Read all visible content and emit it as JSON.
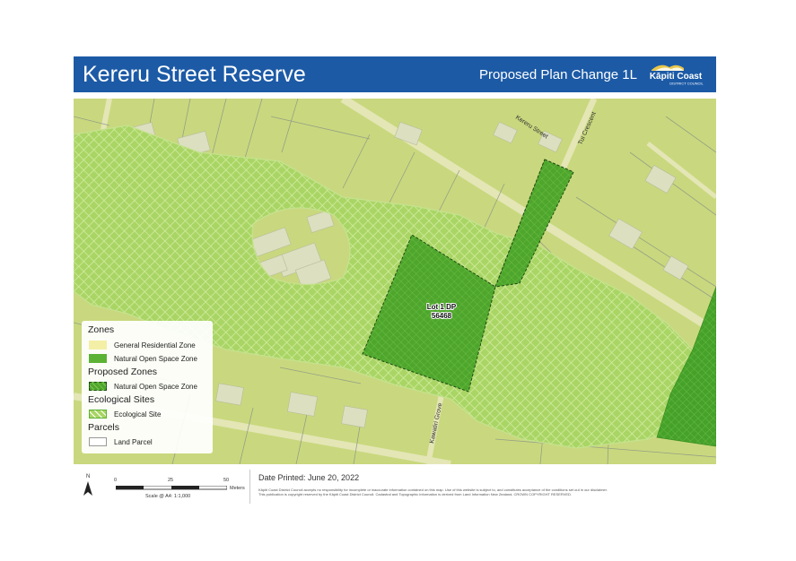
{
  "header": {
    "title": "Kereru Street Reserve",
    "subtitle": "Proposed Plan Change 1L",
    "logo_name": "Kāpiti Coast",
    "logo_sub": "DISTRICT COUNCIL"
  },
  "map": {
    "streets": [
      "Kereru Street",
      "Tui Crescent",
      "Kawatiri Grove"
    ],
    "lot_label_1": "Lot 1 DP",
    "lot_label_2": "56468"
  },
  "legend": {
    "zones_heading": "Zones",
    "general_residential": "General Residential Zone",
    "natural_open_space": "Natural Open Space Zone",
    "proposed_heading": "Proposed Zones",
    "proposed_natural_open_space": "Natural Open Space Zone",
    "ecological_heading": "Ecological Sites",
    "ecological_site": "Ecological Site",
    "parcels_heading": "Parcels",
    "land_parcel": "Land Parcel"
  },
  "footer": {
    "north": "N",
    "scale_0": "0",
    "scale_25": "25",
    "scale_50": "50",
    "scale_unit": "Meters",
    "scale_text": "Scale @ A4: 1:1,000",
    "date_printed": "Date Printed: June 20, 2022",
    "disclaimer_1": "Kāpiti Coast District Council accepts no responsibility for incomplete or inaccurate information contained on this map. Use of this website is subject to, and constitutes acceptance of the conditions set out in our disclaimer.",
    "disclaimer_2": "This publication is copyright reserved by the Kāpiti Coast District Council. Cadastral and Topographic information is derived from Land Information New Zealand, CROWN COPYRIGHT RESERVED."
  },
  "colors": {
    "header_bg": "#1c5aa6",
    "residential_zone": "#d9e07a",
    "natural_open_space": "#5cb234",
    "proposed_zone": "#4aa52b",
    "ecological_site": "#a7d65f"
  }
}
